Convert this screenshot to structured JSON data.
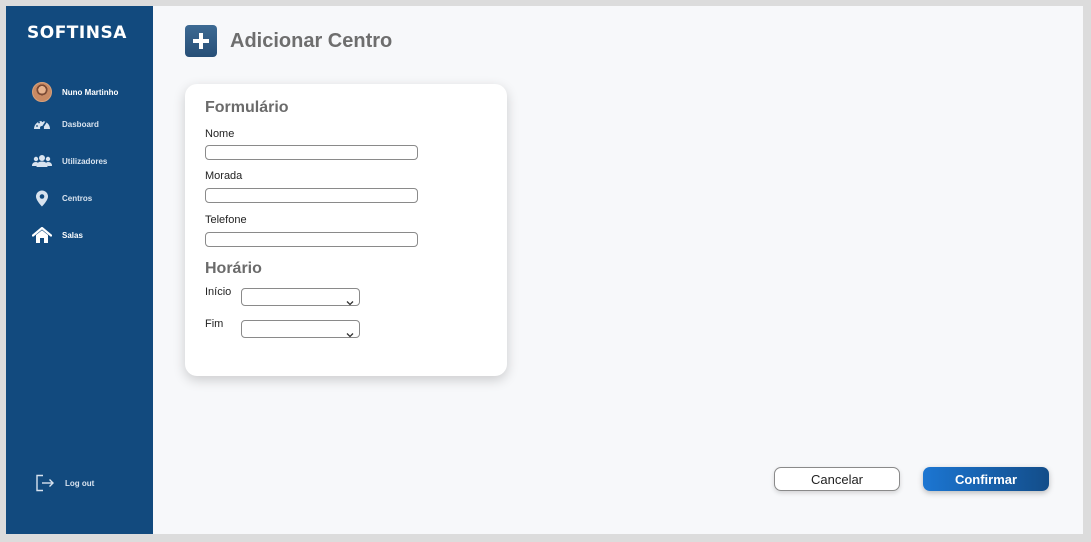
{
  "brand": "SOFTINSA",
  "user": {
    "name": "Nuno Martinho",
    "avatar_icon": "user-avatar"
  },
  "sidebar": {
    "items": [
      {
        "label": "Dasboard",
        "icon": "speedometer-icon"
      },
      {
        "label": "Utilizadores",
        "icon": "users-icon"
      },
      {
        "label": "Centros",
        "icon": "map-pin-icon"
      },
      {
        "label": "Salas",
        "icon": "home-icon",
        "active": true
      }
    ],
    "logout": {
      "label": "Log out",
      "icon": "logout-icon"
    }
  },
  "header": {
    "title": "Adicionar Centro",
    "icon": "plus-icon"
  },
  "form": {
    "title": "Formulário",
    "fields": [
      {
        "label": "Nome",
        "value": "",
        "placeholder": ""
      },
      {
        "label": "Morada",
        "value": "",
        "placeholder": ""
      },
      {
        "label": "Telefone",
        "value": "",
        "placeholder": ""
      }
    ],
    "schedule": {
      "title": "Horário",
      "start": {
        "label": "Início",
        "value": ""
      },
      "end": {
        "label": "Fim",
        "value": ""
      }
    }
  },
  "actions": {
    "cancel": "Cancelar",
    "confirm": "Confirmar"
  },
  "colors": {
    "sidebar": "#124a7e",
    "accent": "#1c76d2",
    "background": "#f7f8fa"
  }
}
